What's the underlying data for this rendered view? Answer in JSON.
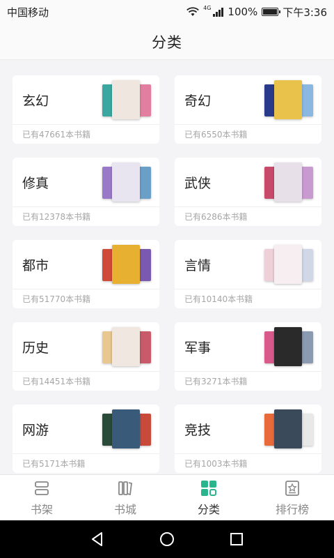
{
  "status_bar": {
    "carrier": "中国移动",
    "network": "4G",
    "battery": "100%",
    "time": "下午3:36",
    "battery_level": 1.0
  },
  "header": {
    "title": "分类"
  },
  "categories": [
    {
      "name": "玄幻",
      "count_text": "已有47661本书籍",
      "colors": [
        "#3aa8a0",
        "#f0e6e0",
        "#e27fa0"
      ]
    },
    {
      "name": "奇幻",
      "count_text": "已有6550本书籍",
      "colors": [
        "#2a3a8a",
        "#e8c24a",
        "#8ab8e0"
      ]
    },
    {
      "name": "修真",
      "count_text": "已有12378本书籍",
      "colors": [
        "#9a7ac8",
        "#e8e4f0",
        "#6aa0c8"
      ]
    },
    {
      "name": "武侠",
      "count_text": "已有6286本书籍",
      "colors": [
        "#c84a6a",
        "#e8e0e8",
        "#c89ad0"
      ]
    },
    {
      "name": "都市",
      "count_text": "已有51770本书籍",
      "colors": [
        "#d04a3a",
        "#e8b030",
        "#7a5ab0"
      ]
    },
    {
      "name": "言情",
      "count_text": "已有10140本书籍",
      "colors": [
        "#f0d0d8",
        "#f6eef0",
        "#d0d8e8"
      ]
    },
    {
      "name": "历史",
      "count_text": "已有14451本书籍",
      "colors": [
        "#e8c890",
        "#f0e8e0",
        "#c85a6a"
      ]
    },
    {
      "name": "军事",
      "count_text": "已有3271本书籍",
      "colors": [
        "#d85a8a",
        "#2a2a2a",
        "#8a9ab0"
      ]
    },
    {
      "name": "网游",
      "count_text": "已有5171本书籍",
      "colors": [
        "#2a4a3a",
        "#3a5a7a",
        "#c84a3a"
      ]
    },
    {
      "name": "竞技",
      "count_text": "已有1003本书籍",
      "colors": [
        "#e86a3a",
        "#3a4a5a",
        "#e8e8e8"
      ]
    }
  ],
  "tabbar": {
    "tabs": [
      {
        "label": "书架",
        "icon": "bookshelf-icon"
      },
      {
        "label": "书城",
        "icon": "bookstore-icon"
      },
      {
        "label": "分类",
        "icon": "category-grid-icon",
        "active": true
      },
      {
        "label": "排行榜",
        "icon": "ranking-icon"
      }
    ],
    "active_color": "#2bb58f",
    "inactive_color": "#888888"
  },
  "navbar": {
    "buttons": [
      "back-icon",
      "home-icon",
      "recent-apps-icon"
    ]
  }
}
